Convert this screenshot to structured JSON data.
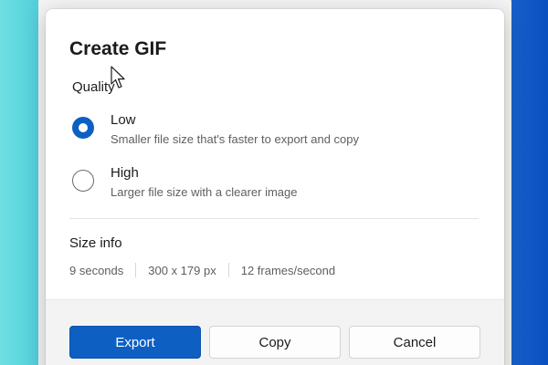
{
  "dialog": {
    "title": "Create GIF",
    "quality_label": "Quality",
    "options": [
      {
        "title": "Low",
        "description": "Smaller file size that's faster to export and copy",
        "selected": true
      },
      {
        "title": "High",
        "description": "Larger file size with a clearer image",
        "selected": false
      }
    ],
    "size_info": {
      "title": "Size info",
      "duration": "9 seconds",
      "dimensions": "300 x 179 px",
      "frame_rate": "12 frames/second"
    },
    "buttons": {
      "export": "Export",
      "copy": "Copy",
      "cancel": "Cancel"
    }
  },
  "colors": {
    "accent": "#0e5fc2",
    "back_heading": "#1e7f5a"
  },
  "icons": {
    "radio_selected": "radio-checked-icon",
    "radio_unselected": "radio-unchecked-icon",
    "cursor": "mouse-pointer-icon"
  }
}
